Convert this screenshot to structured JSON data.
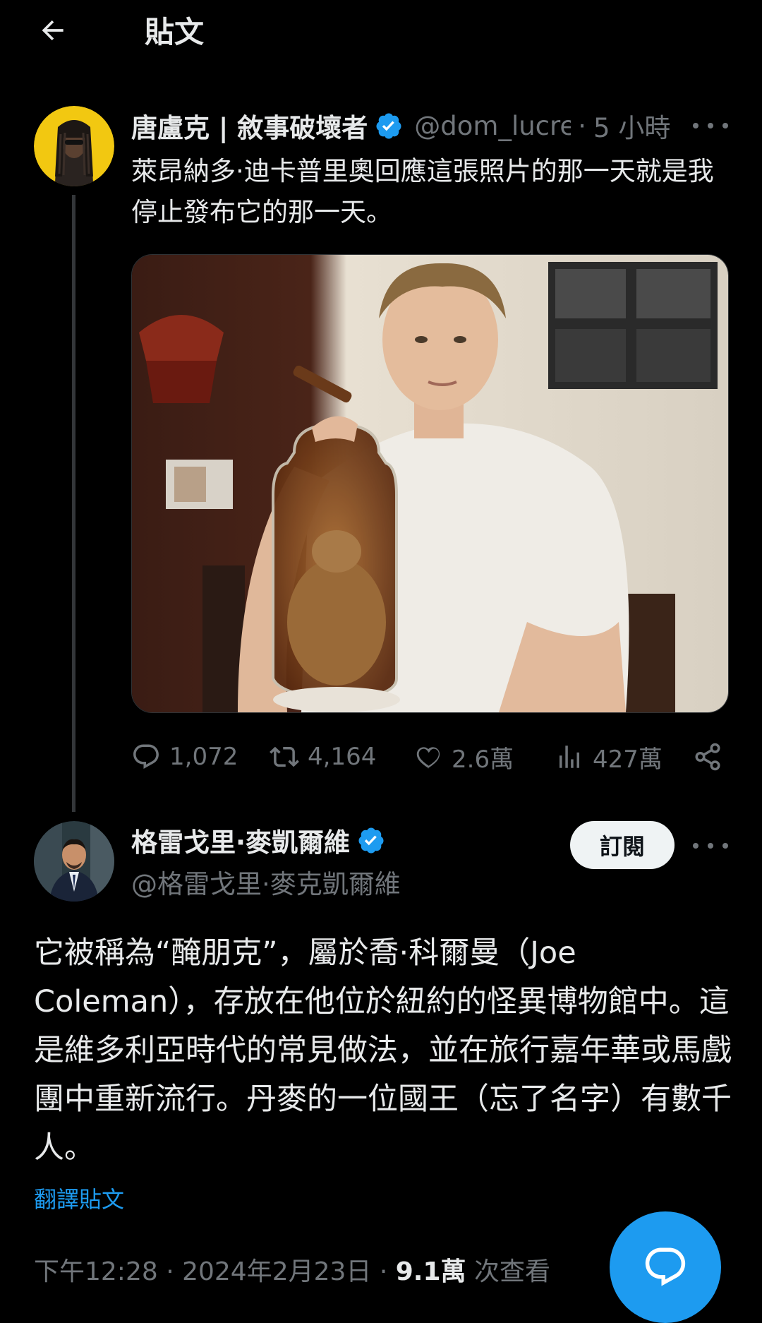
{
  "header": {
    "title": "貼文"
  },
  "parent_tweet": {
    "display_name": "唐盧克 | 敘事破壞者",
    "handle": "@dom_lucre",
    "time": "5 小時",
    "separator": "·",
    "text": "萊昂納多·迪卡普里奧回應這張照片的那一天就是我停止發布它的那一天。",
    "stats": {
      "replies": "1,072",
      "reposts": "4,164",
      "likes": "2.6萬",
      "views": "427萬"
    }
  },
  "focal_tweet": {
    "display_name": "格雷戈里·麥凱爾維",
    "handle": "@格雷戈里·麥克凱爾維",
    "subscribe_label": "訂閱",
    "text": "它被稱為“醃朋克”，屬於喬·科爾曼（Joe Coleman），存放在他位於紐約的怪異博物館中。這是維多利亞時代的常見做法，並在旅行嘉年華或馬戲團中重新流行。丹麥的一位國王（忘了名字）有數千人。",
    "translate_label": "翻譯貼文",
    "timestamp": "下午12:28 · 2024年2月23日 · ",
    "views_count": "9.1萬",
    "views_label": " 次查看"
  },
  "colors": {
    "background": "#000000",
    "text": "#e7e9ea",
    "muted": "#71767b",
    "accent": "#1d9bf0",
    "verified": "#1d9bf0"
  },
  "icons": [
    "back-arrow-icon",
    "verified-badge-icon",
    "more-icon",
    "reply-icon",
    "repost-icon",
    "like-icon",
    "views-icon",
    "share-icon",
    "compose-reply-icon"
  ]
}
